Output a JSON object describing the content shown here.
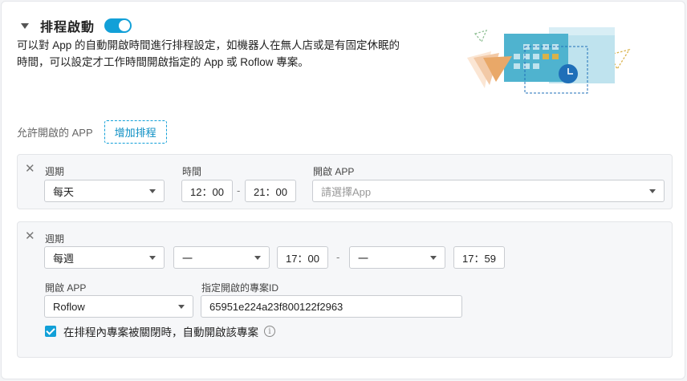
{
  "header": {
    "title": "排程啟動",
    "toggle_on": true,
    "description": "可以對 App 的自動開啟時間進行排程設定，如機器人在無人店或是有固定休眠的時間，可以設定才工作時間開啟指定的 App 或 Roflow 專案。"
  },
  "allowed": {
    "label": "允許開啟的 APP",
    "add_button": "增加排程"
  },
  "schedules": [
    {
      "period_label": "週期",
      "period_value": "每天",
      "time_label": "時間",
      "start_time": "12：00",
      "end_time": "21：00",
      "app_label": "開啟 APP",
      "app_placeholder": "請選擇App"
    },
    {
      "period_label": "週期",
      "period_value": "每週",
      "start_day": "一",
      "start_time": "17：00",
      "end_day": "一",
      "end_time": "17：59",
      "app_label": "開啟 APP",
      "app_value": "Roflow",
      "project_label": "指定開啟的專案ID",
      "project_value": "65951e224a23f800122f2963",
      "auto_open_label": "在排程內專案被關閉時，自動開啟該專案",
      "auto_open_checked": true
    }
  ],
  "symbols": {
    "close": "✕",
    "dash": "-",
    "info": "i"
  },
  "colors": {
    "accent": "#12a0d8",
    "illus_dark_blue": "#4fb3cf",
    "illus_light_blue": "#bfe3ee",
    "illus_peach": "#f2c9a6",
    "illus_orange": "#e9a868",
    "illus_clock": "#1f6fb8",
    "illus_green": "#8fbf94",
    "illus_gold": "#d9b24a"
  }
}
